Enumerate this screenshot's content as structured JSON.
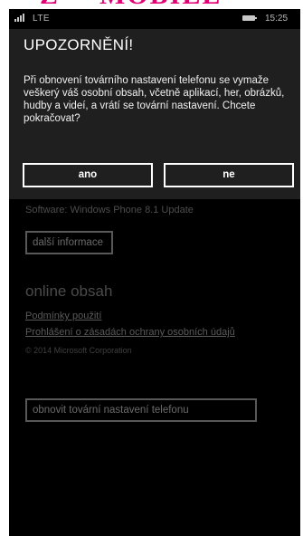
{
  "status": {
    "network": "LTE",
    "time": "15:25"
  },
  "underlay": {
    "cut_text": "Software: Windows Phone 8.1 Update",
    "more_info_label": "další informace",
    "online_title": "online obsah",
    "terms_link": "Podmínky použití",
    "privacy_link": "Prohlášení o zásadách ochrany osobních údajů",
    "copyright": "© 2014 Microsoft Corporation",
    "reset_button_label": "obnovit tovární nastavení telefonu"
  },
  "dialog": {
    "title": "UPOZORNĚNÍ!",
    "message": "Při obnovení továrního nastavení telefonu se vymaže veškerý váš osobní obsah, včetně aplikací, her, obrázků, hudby a videí, a vrátí se tovární nastavení. Chcete pokračovat?",
    "yes_label": "ano",
    "no_label": "ne"
  },
  "colors": {
    "brand": "#e20074",
    "dialog_bg": "#1f1f1f",
    "page_bg": "#000000"
  }
}
